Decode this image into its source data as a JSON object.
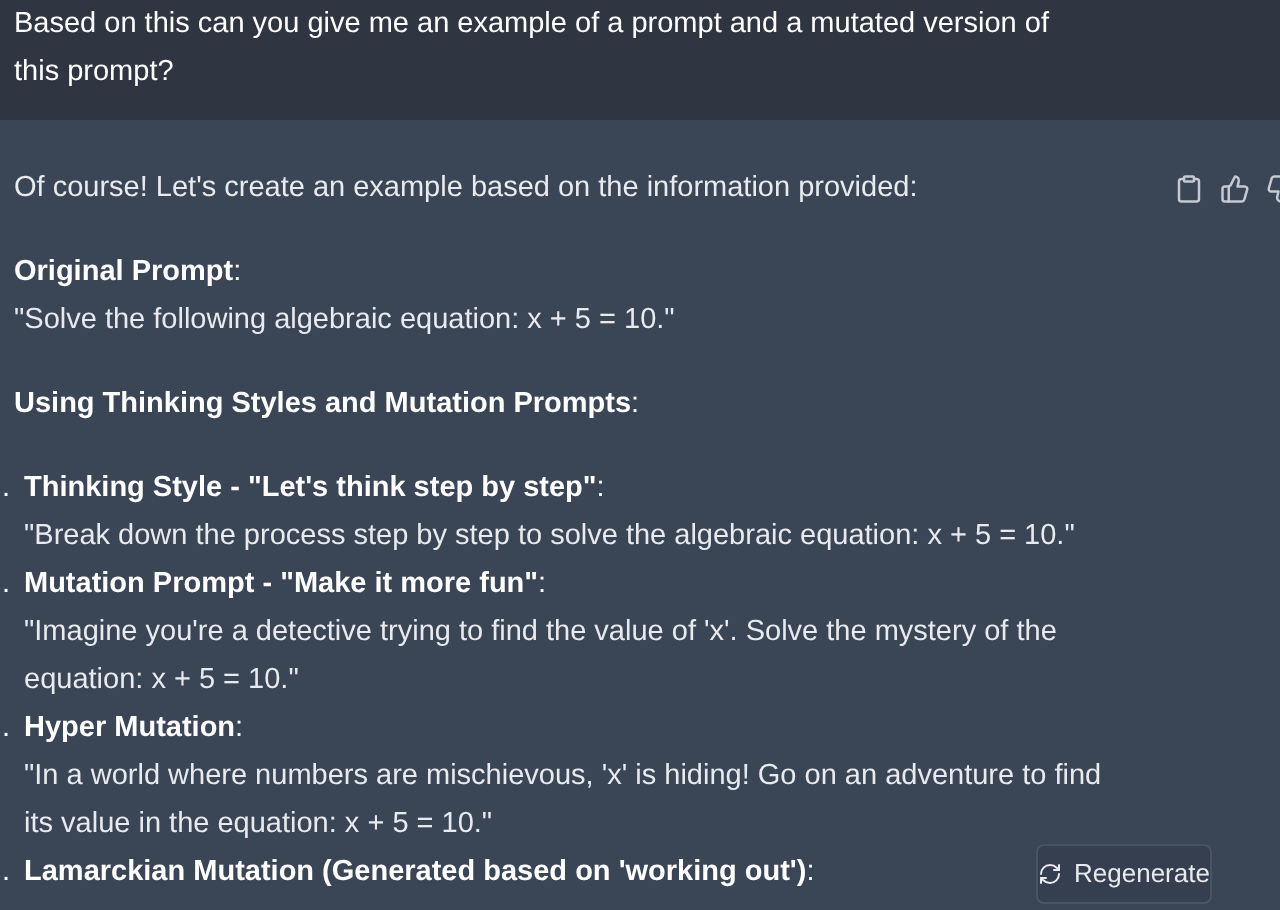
{
  "user_message": {
    "text": "Based on this can you give me an example of a prompt and a mutated version of this prompt?"
  },
  "assistant_message": {
    "intro": "Of course! Let's create an example based on the information provided:",
    "sections": [
      {
        "heading": "**Original Prompt**:",
        "text": "\"Solve the following algebraic equation: x + 5 = 10.\""
      },
      {
        "heading": "**Using Thinking Styles and Mutation Prompts**:"
      }
    ],
    "list": [
      {
        "marker": ".",
        "title": "**Thinking Style - \"Let's think step by step\"**:",
        "text": "\"Break down the process step by step to solve the algebraic equation: x + 5 = 10.\""
      },
      {
        "marker": ".",
        "title": "**Mutation Prompt - \"Make it more fun\"**:",
        "text": "\"Imagine you're a detective trying to find the value of 'x'. Solve the mystery of the equation: x + 5 = 10.\""
      },
      {
        "marker": ".",
        "title": "**Hyper Mutation**:",
        "text": "\"In a world where numbers are mischievous, 'x' is hiding! Go on an adventure to find its value in the equation: x + 5 = 10.\""
      },
      {
        "marker": ".",
        "title": "**Lamarckian Mutation (Generated based on 'working out')**:"
      }
    ]
  },
  "regenerate_button": {
    "label": "Regenerate"
  }
}
